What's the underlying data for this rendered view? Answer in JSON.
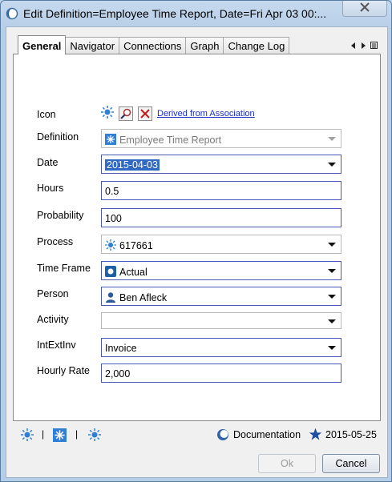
{
  "window": {
    "title": "Edit Definition=Employee Time Report, Date=Fri Apr 03 00:..."
  },
  "tabs": [
    {
      "label": "General",
      "active": true
    },
    {
      "label": "Navigator",
      "active": false
    },
    {
      "label": "Connections",
      "active": false
    },
    {
      "label": "Graph",
      "active": false
    },
    {
      "label": "Change Log",
      "active": false
    }
  ],
  "form": {
    "icon": {
      "label": "Icon",
      "link": "Derived from Association"
    },
    "definition": {
      "label": "Definition",
      "value": "Employee Time Report"
    },
    "date": {
      "label": "Date",
      "value": "2015-04-03"
    },
    "hours": {
      "label": "Hours",
      "value": "0.5"
    },
    "probability": {
      "label": "Probability",
      "value": "100"
    },
    "process": {
      "label": "Process",
      "value": "617661"
    },
    "time_frame": {
      "label": "Time Frame",
      "value": "Actual"
    },
    "person": {
      "label": "Person",
      "value": "Ben Afleck"
    },
    "activity": {
      "label": "Activity",
      "value": ""
    },
    "intextinv": {
      "label": "IntExtInv",
      "value": "Invoice"
    },
    "hourly_rate": {
      "label": "Hourly Rate",
      "value": "2,000"
    }
  },
  "footer": {
    "documentation": "Documentation",
    "date": "2015-05-25",
    "separator": "|"
  },
  "buttons": {
    "ok": "Ok",
    "cancel": "Cancel"
  },
  "colors": {
    "field_border": "#4a59b0",
    "selection": "#316ac5",
    "link": "#1a2ec4",
    "star": "#1f4f9e"
  }
}
